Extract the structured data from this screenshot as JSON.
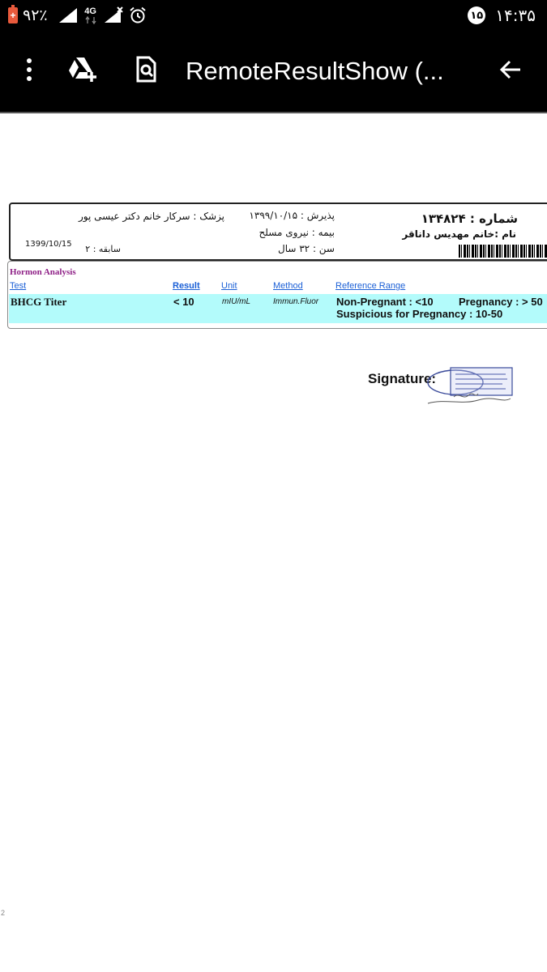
{
  "status_bar": {
    "battery": "۹۲٪",
    "network": "4G",
    "notification_count": "۱۵",
    "time": "۱۴:۳۵",
    "battery_color": "#e85a3c"
  },
  "app_bar": {
    "title": "RemoteResultShow (...",
    "icons": [
      "more-vert-icon",
      "drive-add-icon",
      "find-in-page-icon",
      "back-arrow-icon"
    ]
  },
  "report": {
    "header": {
      "number_label": "شماره : ۱۳۴۸۲۴",
      "name": "نام :خانم مهدیس داناقر",
      "reception": "پذیرش : ۱۳۹۹/۱۰/۱۵",
      "insurance": "بیمه : نیروی مسلح",
      "age": "سن :  ۳۲ سال",
      "doctor": "پزشک : سرکار خانم دکتر عیسی پور",
      "history": "سابقه : ۲",
      "date": "1399/10/15"
    },
    "section_title": "Hormon Analysis",
    "columns": [
      "Test",
      "Result",
      "Unit",
      "Method",
      "Reference Range"
    ],
    "rows": [
      {
        "test": "BHCG Titer",
        "result": "< 10",
        "unit": "mIU/mL",
        "method": "Immun.Fluor",
        "reference_1": "Non-Pregnant : <10",
        "reference_2": "Pregnancy : > 50",
        "reference_3": "Suspicious for Pregnancy : 10-50"
      }
    ],
    "signature_label": "Signature:",
    "page_number": "2"
  }
}
